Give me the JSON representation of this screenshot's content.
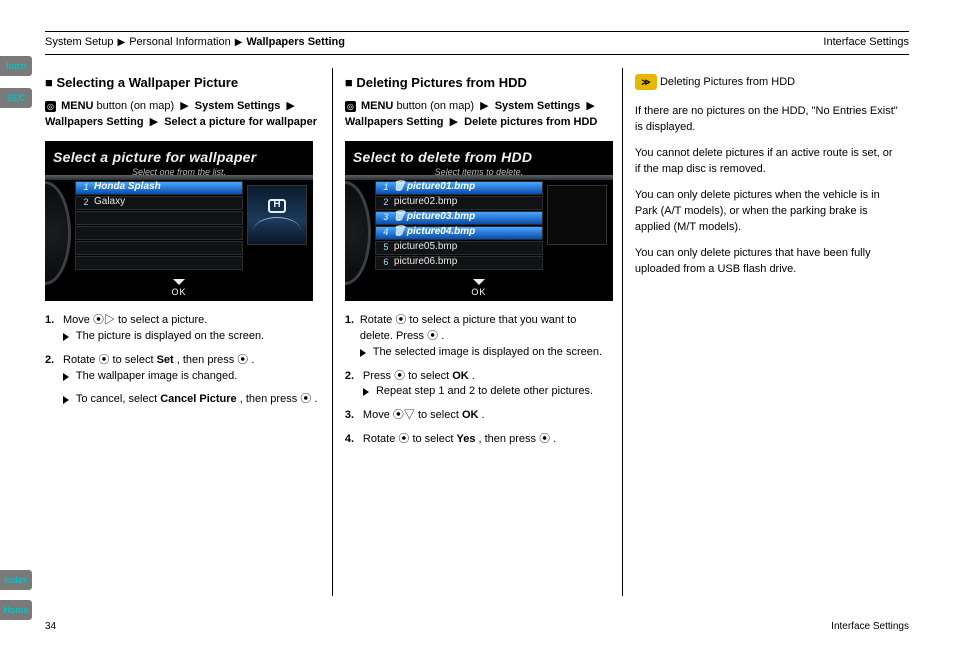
{
  "side_tabs": {
    "intro": "Intro",
    "sec": "SEC",
    "index": "Index",
    "home": "Home"
  },
  "header": {
    "crumb1": "System Setup",
    "crumb2": "Personal Information",
    "crumb3": "Wallpapers Setting",
    "page_title": "Interface Settings"
  },
  "col1": {
    "heading": "Selecting a Wallpaper Picture",
    "menu_btn": "MENU",
    "menu_path_rest": "button (on map)",
    "menu_tail": "System Settings",
    "menu_tail2": "Wallpapers Setting",
    "menu_tail3": "Select a picture for wallpaper",
    "device": {
      "title": "Select a picture for wallpaper",
      "subtitle": "Select one from the list.",
      "items": [
        {
          "n": "1",
          "label": "Honda Splash",
          "selected": true
        },
        {
          "n": "2",
          "label": "Galaxy",
          "selected": false
        }
      ],
      "ok": "OK"
    },
    "step1_n": "1.",
    "step1": "Move ",
    "step1_mid": " to select a picture. ",
    "step1_end": "The picture is displayed on the screen.",
    "step2_n": "2.",
    "step2_a": "Rotate ",
    "step2_b": " to select ",
    "step2_set": "Set",
    "step2_c": ", then press ",
    "step2_d": ".",
    "step2_end": "The wallpaper image is changed.",
    "note_cancel_a": "To cancel, select ",
    "note_cancel_b": "Cancel Picture",
    "note_cancel_c": ", then press ",
    "note_cancel_d": "."
  },
  "col2": {
    "heading": "Deleting Pictures from HDD",
    "menu_btn": "MENU",
    "menu_path_rest": "button (on map)",
    "menu_tail": "System Settings",
    "menu_tail2": "Wallpapers Setting",
    "menu_tail3": "Delete pictures from HDD",
    "device": {
      "title": "Select to delete from HDD",
      "subtitle": "Select items to delete.",
      "items": [
        {
          "n": "1",
          "label": "picture01.bmp",
          "selected": true,
          "trash": true
        },
        {
          "n": "2",
          "label": "picture02.bmp",
          "selected": false
        },
        {
          "n": "3",
          "label": "picture03.bmp",
          "selected": true,
          "trash": true
        },
        {
          "n": "4",
          "label": "picture04.bmp",
          "selected": true,
          "trash": true
        },
        {
          "n": "5",
          "label": "picture05.bmp",
          "selected": false
        },
        {
          "n": "6",
          "label": "picture06.bmp",
          "selected": false
        }
      ],
      "ok": "OK"
    },
    "step1_n": "1.",
    "step1_a": "Rotate ",
    "step1_b": " to select a picture that you want to delete. Press ",
    "step1_c": ".",
    "step1_end": "The selected image is displayed on the screen.",
    "step2_n": "2.",
    "step2_a": "Press ",
    "step2_b": " to select ",
    "step2_ok": "OK",
    "step2_c": ".",
    "step2_end": "Repeat step 1 and 2 to delete other pictures.",
    "step3_n": "3.",
    "step3_a": "Move ",
    "step3_b": " to select ",
    "step3_ok": "OK",
    "step3_c": ".",
    "step4_n": "4.",
    "step4_a": "Rotate ",
    "step4_b": " to select ",
    "step4_yes": "Yes",
    "step4_c": ", then press ",
    "step4_d": "."
  },
  "col3": {
    "note_label": "≫",
    "note_heading": "Deleting Pictures from HDD",
    "p1": "If there are no pictures on the HDD, \"No Entries Exist\" is displayed.",
    "p2": "You cannot delete pictures if an active route is set, or if the map disc is removed.",
    "p3_a": "You can only delete pictures when the vehicle is in Park (A/T models), or when the parking brake is applied (M/T models).",
    "p4_a": "You can only delete pictures that have been fully uploaded from a USB flash drive."
  },
  "footer": {
    "page": "34",
    "right": "Interface Settings"
  }
}
